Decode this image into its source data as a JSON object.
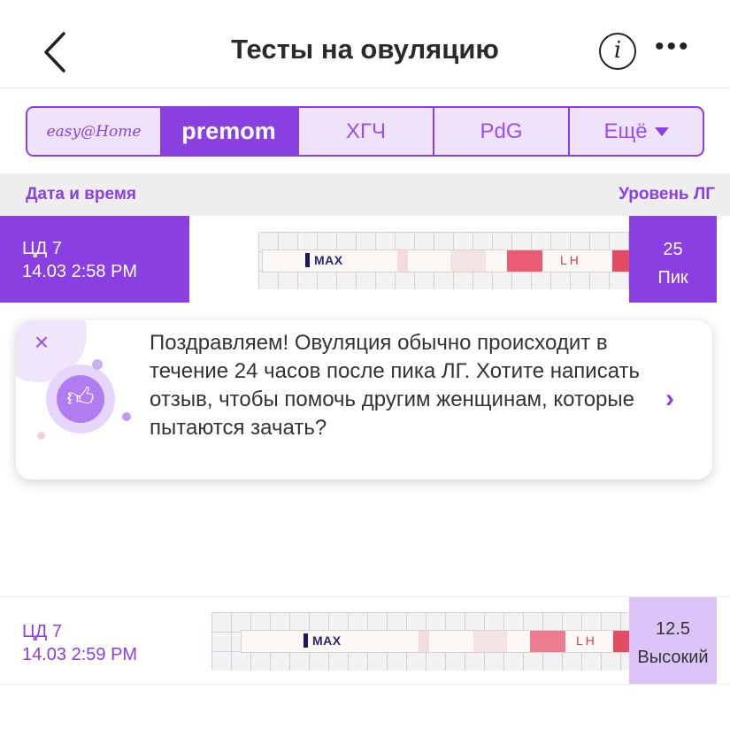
{
  "header": {
    "title": "Тесты на овуляцию",
    "info_icon": "i"
  },
  "tabs": [
    {
      "label": "easy@Home",
      "icon": "easy-home-logo",
      "active": false
    },
    {
      "label": "premom",
      "icon": "premom-logo",
      "active": true
    },
    {
      "label": "ХГЧ",
      "active": false
    },
    {
      "label": "PdG",
      "active": false
    },
    {
      "label": "Ещё",
      "active": false
    }
  ],
  "columns": {
    "left": "Дата и время",
    "right": "Уровень ЛГ"
  },
  "records": [
    {
      "cycle_day": "ЦД 7",
      "datetime": "14.03 2:58 PM",
      "level": "25",
      "status": "Пик",
      "strip_max_label": "MAX",
      "strip_lh_label": "LH"
    },
    {
      "cycle_day": "ЦД 7",
      "datetime": "14.03 2:59 PM",
      "level": "12.5",
      "status": "Высокий",
      "strip_max_label": "MAX",
      "strip_lh_label": "LH"
    }
  ],
  "popup": {
    "message": "Поздравляем! Овуляция обычно происходит в течение 24 часов после пика ЛГ. Хотите написать отзыв, чтобы помочь другим женщинам, которые пытаются зачать?",
    "close_icon": "close-icon",
    "arrow_icon": "chevron-right-icon"
  },
  "colors": {
    "accent": "#8a3fe0",
    "accent_light": "#dcc4f8",
    "tab_bg": "#efe3fb",
    "lh_line": "#d63a56"
  }
}
